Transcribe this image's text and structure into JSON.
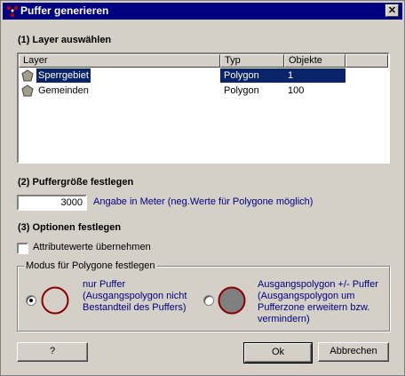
{
  "window": {
    "title": "Puffer generieren",
    "close_symbol": "✕"
  },
  "section1": {
    "label": "(1) Layer auswählen"
  },
  "table": {
    "columns": [
      "Layer",
      "Typ",
      "Objekte"
    ],
    "rows": [
      {
        "layer": "Sperrgebiet",
        "typ": "Polygon",
        "objekte": "1",
        "selected": true
      },
      {
        "layer": "Gemeinden",
        "typ": "Polygon",
        "objekte": "100",
        "selected": false
      }
    ]
  },
  "section2": {
    "label": "(2) Puffergröße festlegen",
    "value": "3000",
    "hint": "Angabe in Meter (neg.Werte für Polygone möglich)"
  },
  "section3": {
    "label": "(3) Optionen festlegen",
    "checkbox_label": "Attributewerte übernehmen",
    "checked": false
  },
  "modus": {
    "label": "Modus für Polygone festlegen",
    "option1": {
      "line1": "nur Puffer",
      "line2": "(Ausgangspolygon nicht",
      "line3": "Bestandteil des Puffers)",
      "selected": true
    },
    "option2": {
      "line1": "Ausgangspolygon +/- Puffer",
      "line2": "(Ausgangspolygon um",
      "line3": "Pufferzone erweitern bzw.",
      "line4": "vermindern)",
      "selected": false
    }
  },
  "buttons": {
    "help": "?",
    "ok": "Ok",
    "cancel": "Abbrechen"
  },
  "colors": {
    "title_bar": "#000080",
    "selection": "#0a246a",
    "ring": "#8b0000",
    "fill_gray": "#808080",
    "hint_text": "#000080"
  },
  "icons": [
    "app-icon",
    "close-icon",
    "layer-polygon-icon",
    "ring-icon",
    "filled-ring-icon"
  ]
}
